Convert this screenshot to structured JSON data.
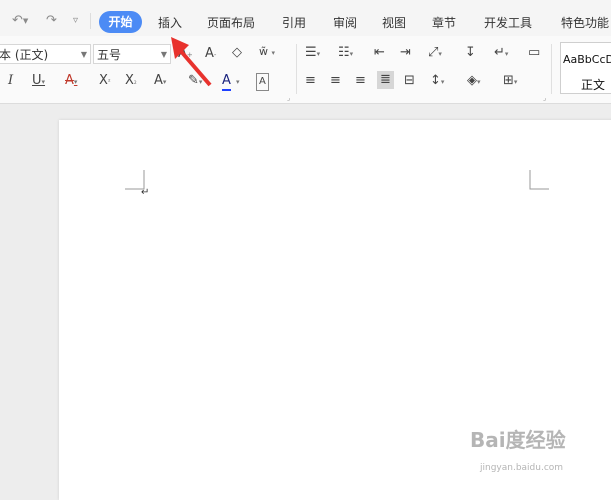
{
  "tabs": {
    "active": "开始",
    "items": [
      "插入",
      "页面布局",
      "引用",
      "审阅",
      "视图",
      "章节",
      "开发工具",
      "特色功能"
    ]
  },
  "font": {
    "family_value": "本 (正文)",
    "size_value": "五号"
  },
  "styles": {
    "preview": "AaBbCcDd",
    "name": "正文"
  },
  "annotation_color": "#e8322d",
  "accent_color": "#4c8bf5",
  "watermark": {
    "brand": "Bai度经验",
    "url": "jingyan.baidu.com"
  }
}
